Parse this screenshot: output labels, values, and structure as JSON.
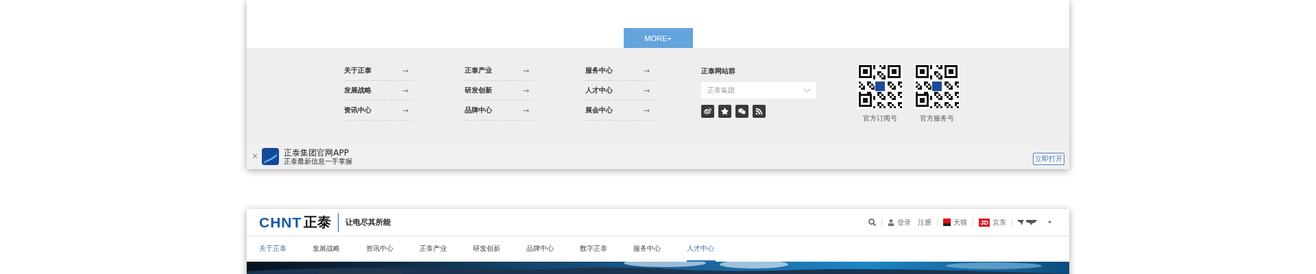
{
  "more_button": "MORE+",
  "footer_columns": [
    [
      {
        "label": "关于正泰",
        "arrow": "→"
      },
      {
        "label": "发展战略",
        "arrow": "→"
      },
      {
        "label": "资讯中心",
        "arrow": "→"
      }
    ],
    [
      {
        "label": "正泰产业",
        "arrow": "→"
      },
      {
        "label": "研发创新",
        "arrow": "→"
      },
      {
        "label": "品牌中心",
        "arrow": "→"
      }
    ],
    [
      {
        "label": "服务中心",
        "arrow": "→"
      },
      {
        "label": "人才中心",
        "arrow": "→"
      },
      {
        "label": "展会中心",
        "arrow": "→"
      }
    ]
  ],
  "site_group": {
    "title": "正泰网站群",
    "select": {
      "value": "正泰集团"
    },
    "social": [
      {
        "kind": "weibo"
      },
      {
        "kind": "star"
      },
      {
        "kind": "wechat"
      },
      {
        "kind": "rss"
      }
    ]
  },
  "qr_codes": [
    {
      "label": "官方订阅号"
    },
    {
      "label": "官方服务号"
    }
  ],
  "app_banner": {
    "close": "×",
    "title": "正泰集团官网APP",
    "subtitle": "正泰最新信息一手掌握",
    "open_button": "立即打开"
  },
  "header": {
    "logo": {
      "latin": "CHNT",
      "chinese": "正泰"
    },
    "slogan": "让电尽其所能",
    "utility_groups": [
      [
        {
          "kind": "search"
        }
      ],
      [
        {
          "kind": "login",
          "label": "登录"
        },
        {
          "kind": "text",
          "label": "注册"
        }
      ],
      [
        {
          "kind": "tmall",
          "label": "天猫"
        }
      ],
      [
        {
          "kind": "jd",
          "label": "京东",
          "badge": "JD"
        }
      ],
      [
        {
          "kind": "language"
        }
      ]
    ]
  },
  "nav": [
    {
      "label": "关于正泰",
      "highlighted": true,
      "selected": false
    },
    {
      "label": "发展战略",
      "highlighted": false,
      "selected": false
    },
    {
      "label": "资讯中心",
      "highlighted": false,
      "selected": false
    },
    {
      "label": "正泰产业",
      "highlighted": false,
      "selected": false
    },
    {
      "label": "研发创新",
      "highlighted": false,
      "selected": false
    },
    {
      "label": "品牌中心",
      "highlighted": false,
      "selected": false
    },
    {
      "label": "数字正泰",
      "highlighted": false,
      "selected": false
    },
    {
      "label": "服务中心",
      "highlighted": false,
      "selected": false
    },
    {
      "label": "人才中心",
      "highlighted": true,
      "selected": true
    }
  ]
}
